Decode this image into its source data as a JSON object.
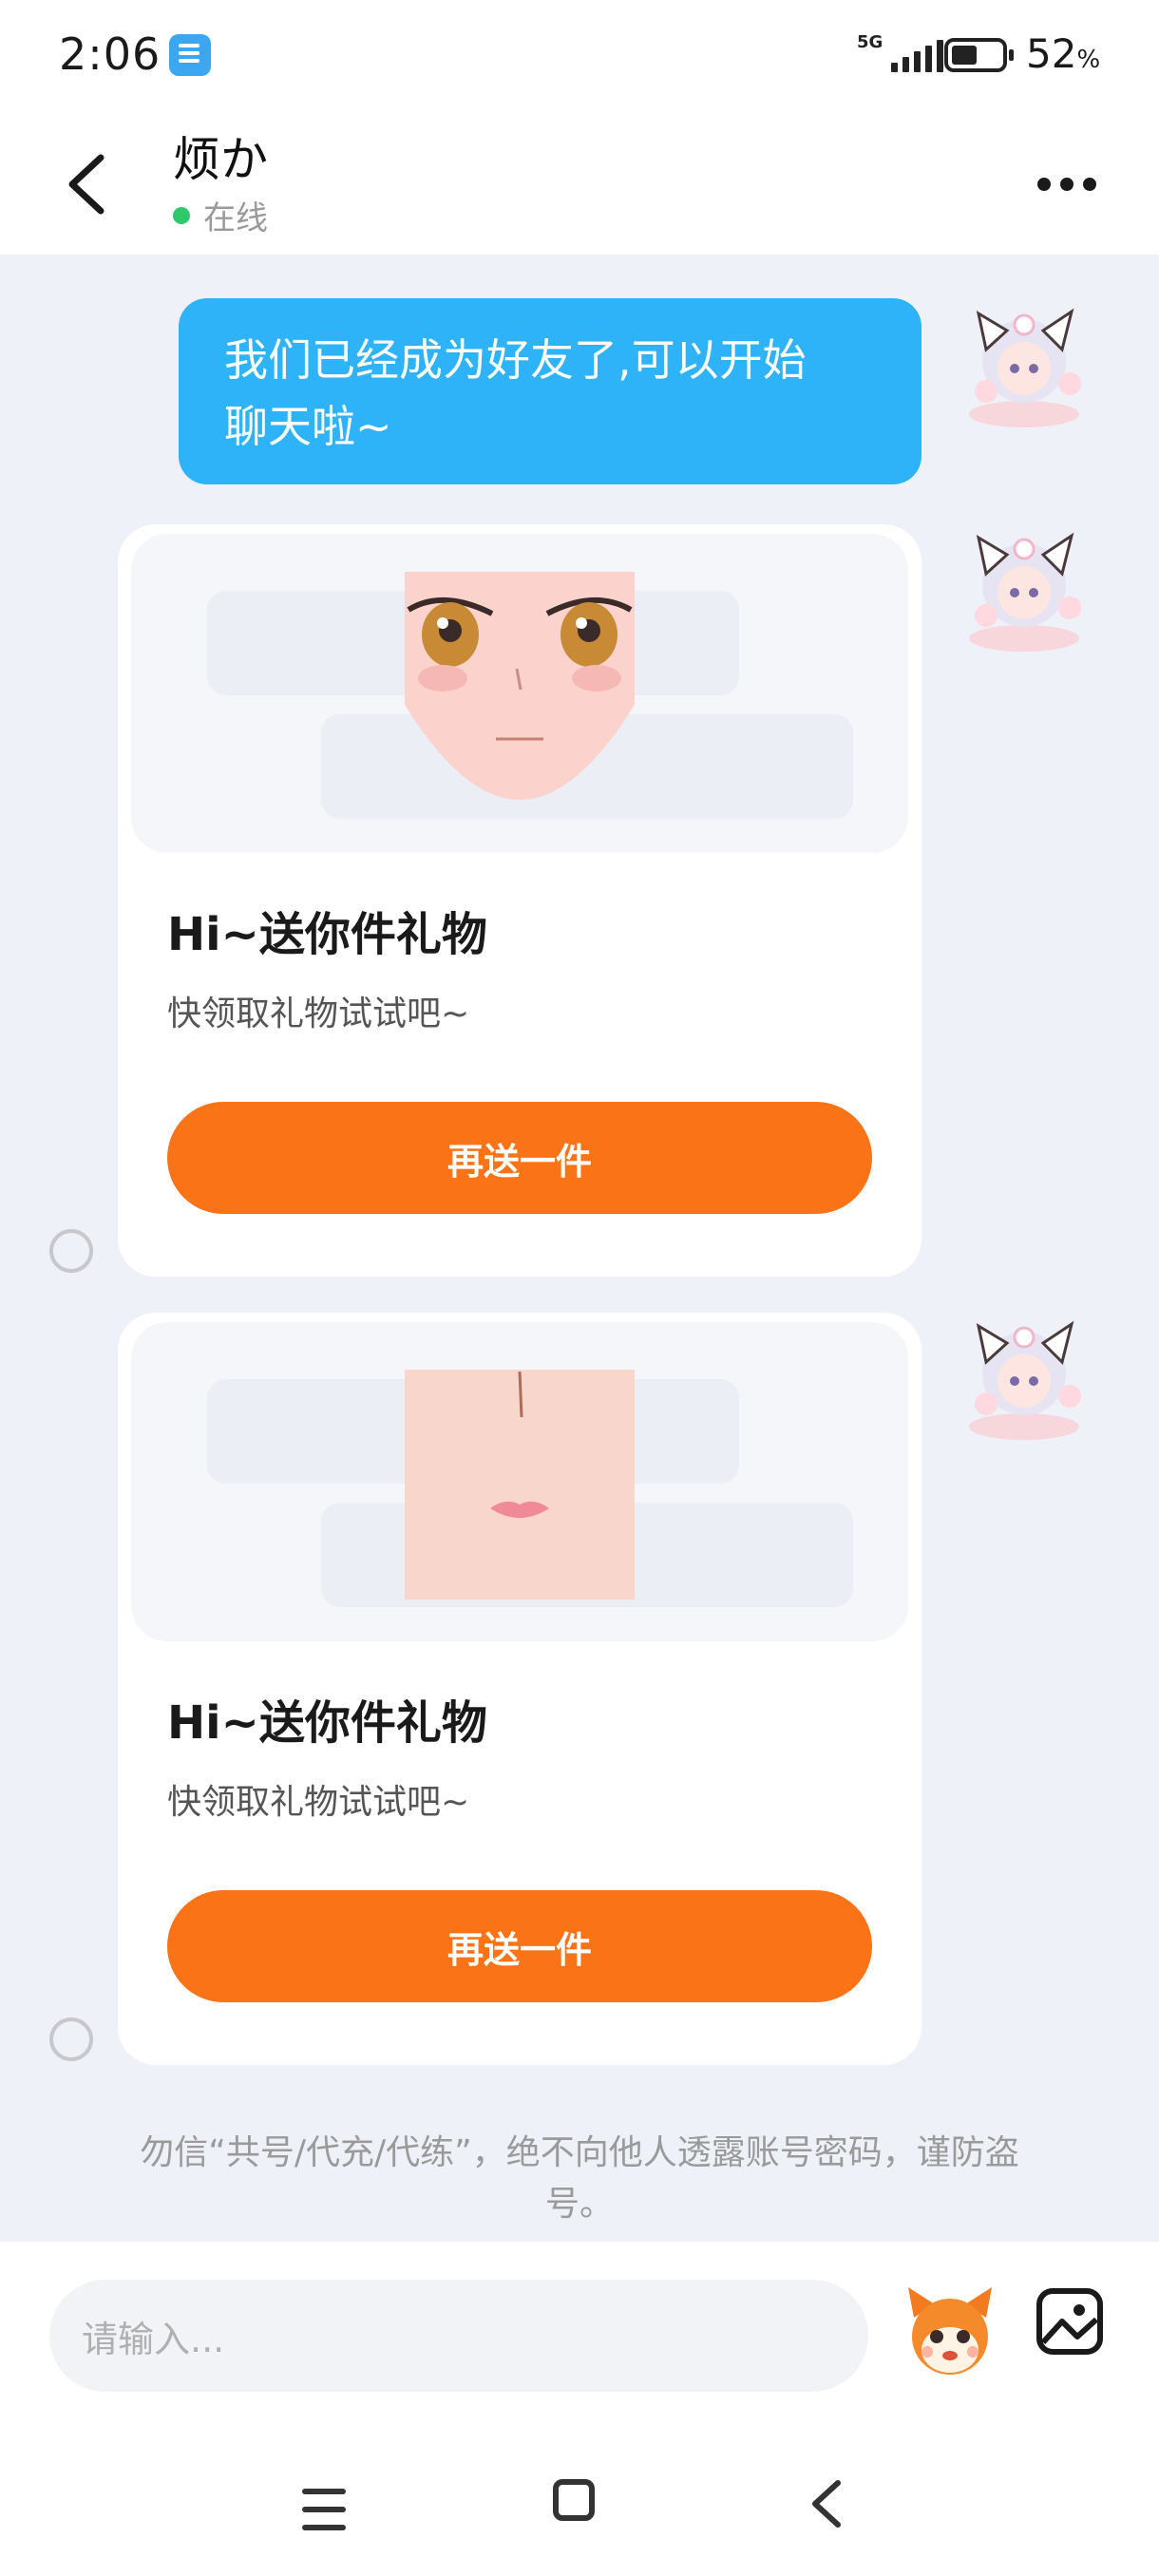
{
  "status_bar": {
    "time": "2:06",
    "network": "5G",
    "battery_level": 0.52,
    "battery_percent": "52",
    "battery_unit": "%"
  },
  "header": {
    "contact_name": "烦か",
    "presence": "在线",
    "presence_color": "#2fc96b"
  },
  "messages": [
    {
      "type": "text",
      "text_line1": "我们已经成为好友了,可以开始",
      "text_line2": "聊天啦~"
    },
    {
      "type": "gift",
      "image_icon": "face-eyes-image",
      "title": "Hi~送你件礼物",
      "subtitle": "快领取礼物试试吧~",
      "button_label": "再送一件"
    },
    {
      "type": "gift",
      "image_icon": "face-lips-image",
      "title": "Hi~送你件礼物",
      "subtitle": "快领取礼物试试吧~",
      "button_label": "再送一件"
    }
  ],
  "warning_line1": "勿信“共号/代充/代练”，绝不向他人透露账号密码，谨防盗",
  "warning_line2": "号。",
  "input": {
    "placeholder": "请输入..."
  },
  "icons": {
    "back": "back-arrow-icon",
    "more": "more-dots-icon",
    "sticker": "mascot-icon",
    "image": "image-icon"
  },
  "colors": {
    "bubble": "#2fb3f8",
    "button": "#fa7316",
    "background": "#eef1f7"
  }
}
